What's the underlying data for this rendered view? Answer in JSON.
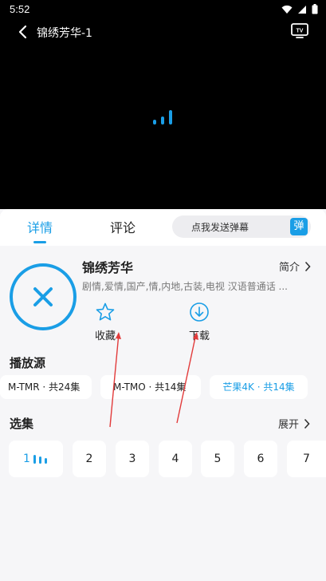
{
  "status_bar": {
    "time": "5:52"
  },
  "player": {
    "title": "锦绣芳华-1"
  },
  "tabs": [
    {
      "label": "详情",
      "active": true
    },
    {
      "label": "评论",
      "active": false
    }
  ],
  "danmaku": {
    "placeholder": "点我发送弹幕",
    "badge": "弹"
  },
  "show": {
    "title": "锦绣芳华",
    "intro_label": "简介",
    "meta": "剧情,爱情,国产,情,内地,古装,电视 汉语普通话 ..."
  },
  "actions": {
    "favorite": "收藏",
    "download": "下载"
  },
  "sources": {
    "title": "播放源",
    "items": [
      "M-TMR · 共24集",
      "M-TMO · 共14集",
      "芒果4K · 共14集"
    ]
  },
  "episodes": {
    "title": "选集",
    "expand_label": "展开",
    "items": [
      "1",
      "2",
      "3",
      "4",
      "5",
      "6",
      "7"
    ]
  },
  "colors": {
    "accent": "#1a9ee6",
    "annotation": "#e23b3b"
  }
}
